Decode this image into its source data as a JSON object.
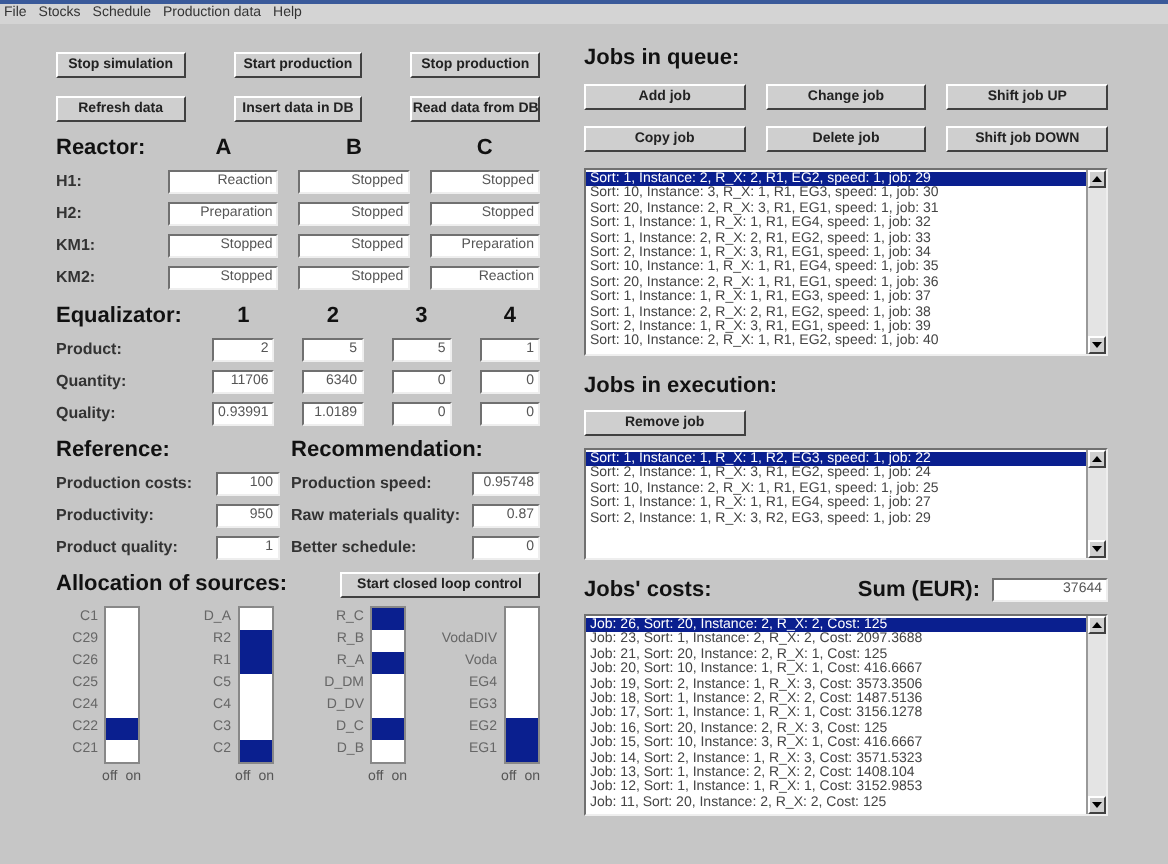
{
  "menu": [
    "File",
    "Stocks",
    "Schedule",
    "Production data",
    "Help"
  ],
  "control_buttons": [
    "Stop simulation",
    "Start production",
    "Stop production",
    "Refresh data",
    "Insert data in DB",
    "Read data from DB"
  ],
  "reactors": {
    "title": "Reactor:",
    "columns": [
      "A",
      "B",
      "C"
    ],
    "rows": [
      {
        "label": "H1:",
        "values": [
          "Reaction",
          "Stopped",
          "Stopped"
        ]
      },
      {
        "label": "H2:",
        "values": [
          "Preparation",
          "Stopped",
          "Stopped"
        ]
      },
      {
        "label": "KM1:",
        "values": [
          "Stopped",
          "Stopped",
          "Preparation"
        ]
      },
      {
        "label": "KM2:",
        "values": [
          "Stopped",
          "Stopped",
          "Reaction"
        ]
      }
    ]
  },
  "equalizator": {
    "title": "Equalizator:",
    "columns": [
      "1",
      "2",
      "3",
      "4"
    ],
    "rows": [
      {
        "label": "Product:",
        "values": [
          "2",
          "5",
          "5",
          "1"
        ]
      },
      {
        "label": "Quantity:",
        "values": [
          "11706",
          "6340",
          "0",
          "0"
        ]
      },
      {
        "label": "Quality:",
        "values": [
          "0.93991",
          "1.0189",
          "0",
          "0"
        ]
      }
    ]
  },
  "reference": {
    "title": "Reference:",
    "rows": [
      {
        "label": "Production costs:",
        "value": "100"
      },
      {
        "label": "Productivity:",
        "value": "950"
      },
      {
        "label": "Product quality:",
        "value": "1"
      }
    ]
  },
  "recommendation": {
    "title": "Recommendation:",
    "rows": [
      {
        "label": "Production speed:",
        "value": "0.95748"
      },
      {
        "label": "Raw materials quality:",
        "value": "0.87"
      },
      {
        "label": "Better schedule:",
        "value": "0"
      }
    ]
  },
  "allocation": {
    "title": "Allocation of sources:",
    "button": "Start closed loop control",
    "groups": [
      {
        "axis": [
          "off",
          "on"
        ],
        "items": [
          {
            "label": "C1",
            "on": false
          },
          {
            "label": "C29",
            "on": false
          },
          {
            "label": "C26",
            "on": false
          },
          {
            "label": "C25",
            "on": false
          },
          {
            "label": "C24",
            "on": false
          },
          {
            "label": "C22",
            "on": true
          },
          {
            "label": "C21",
            "on": false
          }
        ]
      },
      {
        "axis": [
          "off",
          "on"
        ],
        "items": [
          {
            "label": "D_A",
            "on": false
          },
          {
            "label": "R2",
            "on": true
          },
          {
            "label": "R1",
            "on": true
          },
          {
            "label": "C5",
            "on": false
          },
          {
            "label": "C4",
            "on": false
          },
          {
            "label": "C3",
            "on": false
          },
          {
            "label": "C2",
            "on": true
          }
        ]
      },
      {
        "axis": [
          "off",
          "on"
        ],
        "items": [
          {
            "label": "R_C",
            "on": true
          },
          {
            "label": "R_B",
            "on": false
          },
          {
            "label": "R_A",
            "on": true
          },
          {
            "label": "D_DM",
            "on": false
          },
          {
            "label": "D_DV",
            "on": false
          },
          {
            "label": "D_C",
            "on": true
          },
          {
            "label": "D_B",
            "on": false
          }
        ]
      },
      {
        "axis": [
          "off",
          "on"
        ],
        "items": [
          {
            "label": "VodaDIV",
            "on": false
          },
          {
            "label": "Voda",
            "on": false
          },
          {
            "label": "EG4",
            "on": false
          },
          {
            "label": "EG3",
            "on": false
          },
          {
            "label": "EG2",
            "on": true
          },
          {
            "label": "EG1",
            "on": true
          }
        ]
      }
    ]
  },
  "queue": {
    "title": "Jobs in queue:",
    "buttons": [
      "Add job",
      "Change job",
      "Shift job UP",
      "Copy job",
      "Delete job",
      "Shift job DOWN"
    ],
    "items": [
      {
        "text": "Sort: 1, Instance: 2, R_X: 2, R1, EG2, speed: 1, job: 29",
        "selected": true
      },
      {
        "text": "Sort: 10, Instance: 3, R_X: 1, R1, EG3, speed: 1, job: 30",
        "selected": false
      },
      {
        "text": "Sort: 20, Instance: 2, R_X: 3, R1, EG1, speed: 1, job: 31",
        "selected": false
      },
      {
        "text": "Sort: 1, Instance: 1, R_X: 1, R1, EG4, speed: 1, job: 32",
        "selected": false
      },
      {
        "text": "Sort: 1, Instance: 2, R_X: 2, R1, EG2, speed: 1, job: 33",
        "selected": false
      },
      {
        "text": "Sort: 2, Instance: 1, R_X: 3, R1, EG1, speed: 1, job: 34",
        "selected": false
      },
      {
        "text": "Sort: 10, Instance: 1, R_X: 1, R1, EG4, speed: 1, job: 35",
        "selected": false
      },
      {
        "text": "Sort: 20, Instance: 2, R_X: 1, R1, EG1, speed: 1, job: 36",
        "selected": false
      },
      {
        "text": "Sort: 1, Instance: 1, R_X: 1, R1, EG3, speed: 1, job: 37",
        "selected": false
      },
      {
        "text": "Sort: 1, Instance: 2, R_X: 2, R1, EG2, speed: 1, job: 38",
        "selected": false
      },
      {
        "text": "Sort: 2, Instance: 1, R_X: 3, R1, EG1, speed: 1, job: 39",
        "selected": false
      },
      {
        "text": "Sort: 10, Instance: 2, R_X: 1, R1, EG2, speed: 1, job: 40",
        "selected": false
      }
    ]
  },
  "execution": {
    "title": "Jobs in execution:",
    "button": "Remove job",
    "items": [
      {
        "text": "Sort: 1, Instance: 1, R_X: 1, R2, EG3, speed: 1, job: 22",
        "selected": true
      },
      {
        "text": "Sort: 2, Instance: 1, R_X: 3, R1, EG2, speed: 1, job: 24",
        "selected": false
      },
      {
        "text": "Sort: 10, Instance: 2, R_X: 1, R1, EG1, speed: 1, job: 25",
        "selected": false
      },
      {
        "text": "Sort: 1, Instance: 1, R_X: 1, R1, EG4, speed: 1, job: 27",
        "selected": false
      },
      {
        "text": "Sort: 2, Instance: 1, R_X: 3, R2, EG3, speed: 1, job: 29",
        "selected": false
      }
    ]
  },
  "costs": {
    "title": "Jobs' costs:",
    "sum_label": "Sum (EUR):",
    "sum": "37644",
    "items": [
      {
        "text": "Job: 26, Sort: 20, Instance: 2, R_X: 2, Cost: 125",
        "selected": true
      },
      {
        "text": "Job: 23, Sort: 1, Instance: 2, R_X: 2, Cost: 2097.3688",
        "selected": false
      },
      {
        "text": "Job: 21, Sort: 20, Instance: 2, R_X: 1, Cost: 125",
        "selected": false
      },
      {
        "text": "Job: 20, Sort: 10, Instance: 1, R_X: 1, Cost: 416.6667",
        "selected": false
      },
      {
        "text": "Job: 19, Sort: 2, Instance: 1, R_X: 3, Cost: 3573.3506",
        "selected": false
      },
      {
        "text": "Job: 18, Sort: 1, Instance: 2, R_X: 2, Cost: 1487.5136",
        "selected": false
      },
      {
        "text": "Job: 17, Sort: 1, Instance: 1, R_X: 1, Cost: 3156.1278",
        "selected": false
      },
      {
        "text": "Job: 16, Sort: 20, Instance: 2, R_X: 3, Cost: 125",
        "selected": false
      },
      {
        "text": "Job: 15, Sort: 10, Instance: 3, R_X: 1, Cost: 416.6667",
        "selected": false
      },
      {
        "text": "Job: 14, Sort: 2, Instance: 1, R_X: 3, Cost: 3571.5323",
        "selected": false
      },
      {
        "text": "Job: 13, Sort: 1, Instance: 2, R_X: 2, Cost: 1408.104",
        "selected": false
      },
      {
        "text": "Job: 12, Sort: 1, Instance: 1, R_X: 1, Cost: 3152.9853",
        "selected": false
      },
      {
        "text": "Job: 11, Sort: 20, Instance: 2, R_X: 2, Cost: 125",
        "selected": false
      }
    ]
  }
}
